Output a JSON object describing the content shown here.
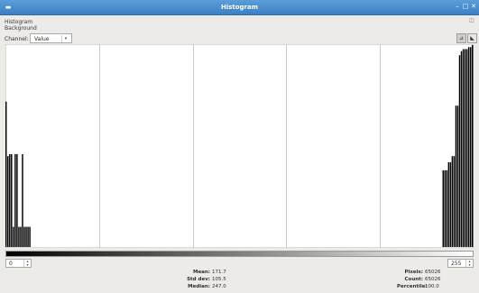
{
  "window": {
    "title": "Histogram",
    "menu_icon": "window-menu-icon",
    "controls": [
      "minimize-icon",
      "maximize-icon",
      "close-icon"
    ]
  },
  "header": {
    "line1": "Histogram",
    "line2": "Background"
  },
  "channel": {
    "label": "Channel:",
    "value": "Value"
  },
  "range": {
    "low": "0",
    "high": "255"
  },
  "stats_left": [
    {
      "label": "Mean:",
      "value": "171.7"
    },
    {
      "label": "Std dev:",
      "value": "105.5"
    },
    {
      "label": "Median:",
      "value": "247.0"
    }
  ],
  "stats_right": [
    {
      "label": "Pixels:",
      "value": "65026"
    },
    {
      "label": "Count:",
      "value": "65026"
    },
    {
      "label": "Percentile:",
      "value": "100.0"
    }
  ],
  "chart_data": {
    "type": "bar",
    "title": "",
    "xlabel": "",
    "ylabel": "",
    "xlim": [
      0,
      255
    ],
    "ylim": [
      0,
      1
    ],
    "grid_divisions": 5,
    "x": [
      0,
      1,
      2,
      3,
      4,
      5,
      6,
      7,
      8,
      9,
      10,
      11,
      12,
      13,
      239,
      240,
      241,
      242,
      243,
      244,
      245,
      246,
      247,
      248,
      249,
      250,
      251,
      252,
      253,
      254,
      255
    ],
    "values": [
      0.72,
      0.45,
      0.46,
      0.46,
      0.1,
      0.46,
      0.46,
      0.1,
      0.1,
      0.46,
      0.1,
      0.1,
      0.1,
      0.1,
      0.38,
      0.38,
      0.38,
      0.42,
      0.42,
      0.45,
      0.45,
      0.7,
      0.7,
      0.95,
      0.97,
      0.98,
      0.98,
      0.98,
      0.99,
      0.99,
      1.0
    ]
  },
  "colors": {
    "titlebar": "#3a7fc4",
    "bars": "#000000",
    "grid": "#c8c8c8",
    "plot_background": "#ffffff"
  }
}
